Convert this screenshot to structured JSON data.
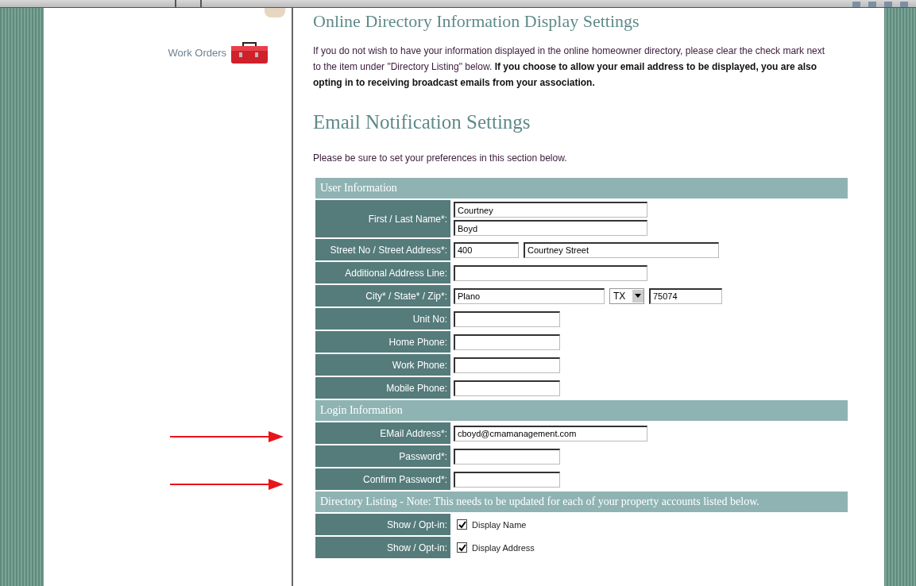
{
  "sidebar": {
    "items": [
      {
        "label": "Work Orders"
      }
    ]
  },
  "top_heading": "Online Directory Information Display Settings",
  "intro": "If you do not wish to have your information displayed in the online homeowner directory, please clear the check mark next to the item under \"Directory Listing\" below. **If you choose to allow your email address to be displayed, you are also opting in to receiving broadcast emails from your association.**",
  "heading": "Email Notification Settings",
  "instructions": "Please be sure to set your preferences in this section below.",
  "form": [
    {
      "kind": "section",
      "title": "User Information"
    },
    {
      "kind": "stacked-fields",
      "label": "First / Last Name*:",
      "fields": [
        {
          "kind": "name",
          "value": "Courtney"
        },
        {
          "kind": "name",
          "value": "Boyd"
        }
      ]
    },
    {
      "kind": "fields",
      "label": "Street No / Street Address*:",
      "fields": [
        {
          "kind": "number",
          "value": "400"
        },
        {
          "kind": "street",
          "value": "Courtney Street"
        }
      ]
    },
    {
      "kind": "fields",
      "label": "Additional Address Line:",
      "fields": [
        {
          "kind": "line"
        }
      ]
    },
    {
      "kind": "fields",
      "label": "City* / State* / Zip*:",
      "fields": [
        {
          "kind": "city",
          "value": "Plano"
        },
        {
          "kind": "state",
          "value": "TX"
        },
        {
          "kind": "zip",
          "value": "75074"
        }
      ]
    },
    {
      "kind": "fields",
      "label": "Unit No:",
      "fields": [
        {
          "kind": "short"
        }
      ]
    },
    {
      "kind": "fields",
      "label": "Home Phone:",
      "fields": [
        {
          "kind": "short"
        }
      ]
    },
    {
      "kind": "fields",
      "label": "Work Phone:",
      "fields": [
        {
          "kind": "short"
        }
      ]
    },
    {
      "kind": "fields",
      "label": "Mobile Phone:",
      "fields": [
        {
          "kind": "short"
        }
      ]
    },
    {
      "kind": "section",
      "title": "Login Information"
    },
    {
      "kind": "fields",
      "label": "EMail Address*:",
      "fields": [
        {
          "kind": "email",
          "value": "cboyd@cmamanagement.com"
        }
      ]
    },
    {
      "kind": "fields",
      "label": "Password*:",
      "fields": [
        {
          "kind": "password"
        }
      ]
    },
    {
      "kind": "fields",
      "label": "Confirm Password*:",
      "fields": [
        {
          "kind": "password"
        }
      ]
    },
    {
      "kind": "section",
      "title": "Directory Listing - Note: This needs to be updated for each of your property accounts listed below."
    },
    {
      "kind": "checkbox",
      "label": "Show / Opt-in:",
      "option": "Display Name",
      "checked": true
    },
    {
      "kind": "checkbox",
      "label": "Show / Opt-in:",
      "option": "Display Address",
      "checked": true
    }
  ]
}
